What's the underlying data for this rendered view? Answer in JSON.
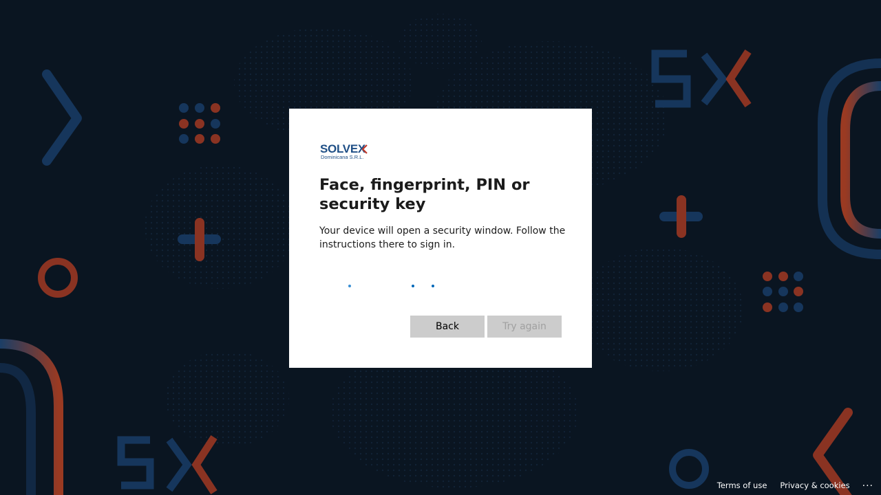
{
  "logo": {
    "brand": "SOLVEX",
    "subtitle": "Dominicana S.R.L.",
    "brand_color": "#1f4f86",
    "accent_color": "#c0392b"
  },
  "dialog": {
    "title": "Face, fingerprint, PIN or security key",
    "description": "Your device will open a security window. Follow the instructions there to sign in.",
    "progress_icon": "loading-dots-icon",
    "back_label": "Back",
    "retry_label": "Try again"
  },
  "footer": {
    "terms_label": "Terms of use",
    "privacy_label": "Privacy & cookies",
    "more_label": "..."
  },
  "colors": {
    "background": "#0a1622",
    "accent_blue": "#0067b8",
    "button_gray": "#cccccc",
    "decor_blue": "#16365c",
    "decor_red": "#8a3322"
  }
}
